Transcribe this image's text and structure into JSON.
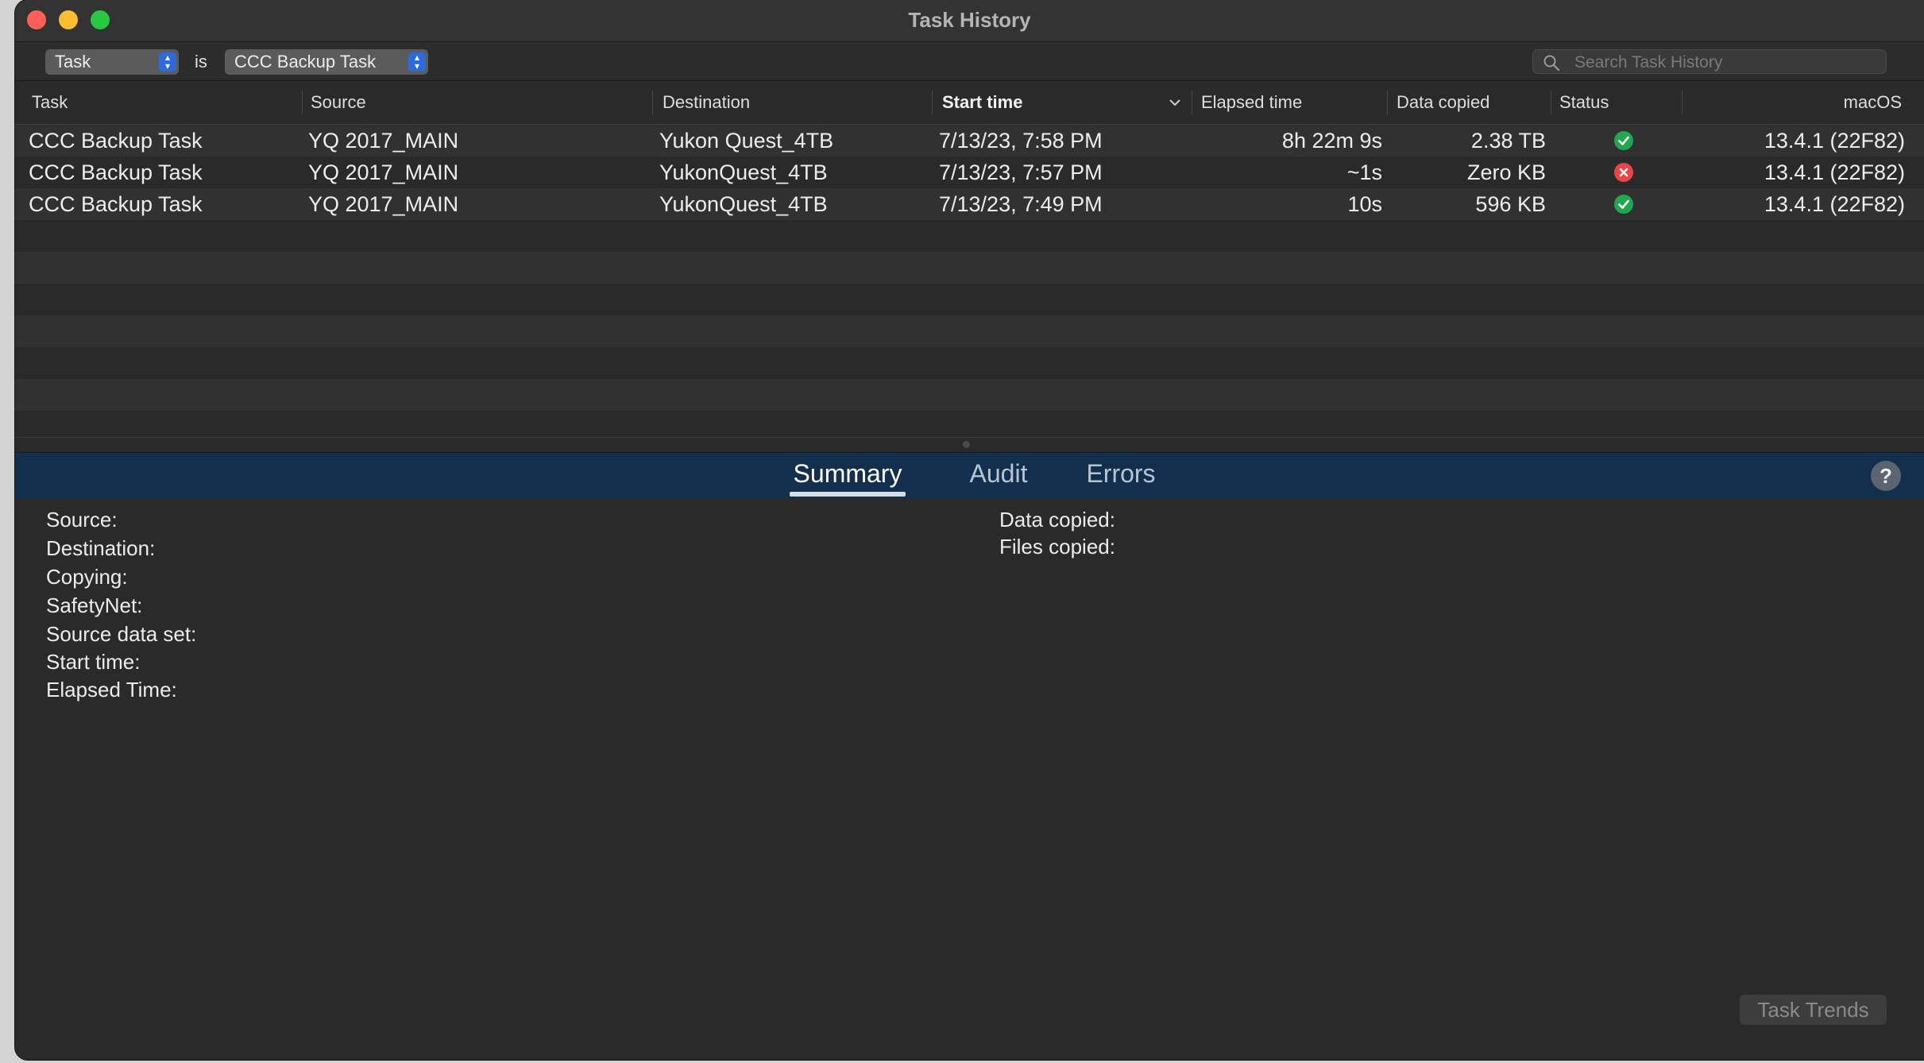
{
  "window": {
    "title": "Task History"
  },
  "filter": {
    "field": "Task",
    "operator": "is",
    "value": "CCC Backup Task",
    "search_placeholder": "Search Task History"
  },
  "columns": [
    "Task",
    "Source",
    "Destination",
    "Start time",
    "Elapsed time",
    "Data copied",
    "Status",
    "macOS"
  ],
  "sorted_column": "Start time",
  "rows": [
    {
      "task": "CCC Backup Task",
      "source": "YQ 2017_MAIN",
      "destination": "Yukon Quest_4TB",
      "start": "7/13/23, 7:58 PM",
      "elapsed": "8h 22m 9s",
      "data": "2.38 TB",
      "status": "success",
      "macos": "13.4.1 (22F82)"
    },
    {
      "task": "CCC Backup Task",
      "source": "YQ 2017_MAIN",
      "destination": "YukonQuest_4TB",
      "start": "7/13/23, 7:57 PM",
      "elapsed": "~1s",
      "data": "Zero KB",
      "status": "error",
      "macos": "13.4.1 (22F82)"
    },
    {
      "task": "CCC Backup Task",
      "source": "YQ 2017_MAIN",
      "destination": "YukonQuest_4TB",
      "start": "7/13/23, 7:49 PM",
      "elapsed": "10s",
      "data": "596 KB",
      "status": "success",
      "macos": "13.4.1 (22F82)"
    }
  ],
  "status_colors": {
    "success": "#1fa84f",
    "error": "#e8454a"
  },
  "tabs": [
    {
      "label": "Summary",
      "active": true
    },
    {
      "label": "Audit",
      "active": false
    },
    {
      "label": "Errors",
      "active": false
    }
  ],
  "summary": {
    "left": [
      "Source:",
      "Destination:",
      "Copying:",
      "SafetyNet:",
      "Source data set:",
      "Start time:",
      "Elapsed Time:"
    ],
    "right": [
      "Data copied:",
      "Files copied:"
    ]
  },
  "buttons": {
    "task_trends": "Task Trends",
    "help": "?"
  }
}
